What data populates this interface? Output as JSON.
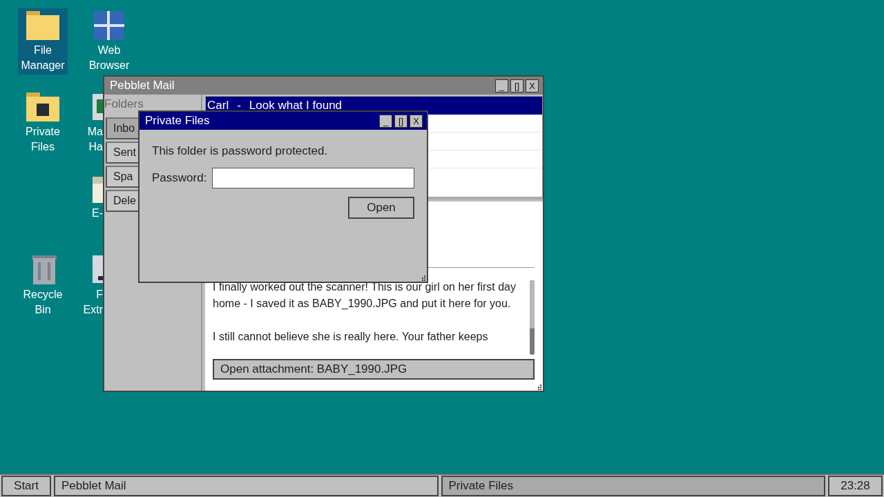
{
  "desktop": {
    "columns": [
      [
        {
          "kind": "folder",
          "label": [
            "File",
            "Manager"
          ],
          "selected": true,
          "cut": false
        },
        {
          "kind": "locked-folder",
          "label": [
            "Private",
            "Files"
          ],
          "selected": false,
          "cut": false
        },
        {
          "kind": "recycle-bin",
          "label": [
            "Recycle",
            "Bin"
          ],
          "selected": false,
          "cut": false
        }
      ],
      [
        {
          "kind": "browser",
          "label": [
            "Web",
            "Browser"
          ],
          "selected": false,
          "cut": false
        },
        {
          "kind": "sheet",
          "label": [
            "Ma",
            "Ha"
          ],
          "selected": false,
          "cut": true
        },
        {
          "kind": "document",
          "label": [
            "E-"
          ],
          "selected": false,
          "cut": true
        },
        {
          "kind": "drive",
          "label": [
            "F",
            "Extr"
          ],
          "selected": false,
          "cut": true
        }
      ]
    ]
  },
  "mail_window": {
    "title": "Pebblet Mail",
    "controls": [
      "_",
      "[]",
      "X"
    ],
    "folders_heading": "Folders",
    "folders": [
      {
        "label": "Inbo",
        "selected": true
      },
      {
        "label": "Sent",
        "selected": false
      },
      {
        "label": "Spa",
        "selected": false
      },
      {
        "label": "Dele",
        "selected": false
      }
    ],
    "messages": [
      {
        "sender": "Carl",
        "separator": "-",
        "subject": "Look what I found",
        "selected": true
      }
    ],
    "body": [
      "I finally worked out the scanner! This is our girl on her first day home - I saved it as BABY_1990.JPG and put it here for you.",
      "I still cannot believe she is really here. Your father keeps"
    ],
    "attachment_button": "Open attachment: BABY_1990.JPG"
  },
  "dialog": {
    "title": "Private Files",
    "controls": [
      "_",
      "[]",
      "X"
    ],
    "message": "This folder is password protected.",
    "password_label": "Password:",
    "button": "Open"
  },
  "taskbar": {
    "start": "Start",
    "tasks": [
      {
        "label": "Pebblet Mail",
        "selected": false
      },
      {
        "label": "Private Files",
        "selected": true
      }
    ],
    "clock": "23:28"
  }
}
